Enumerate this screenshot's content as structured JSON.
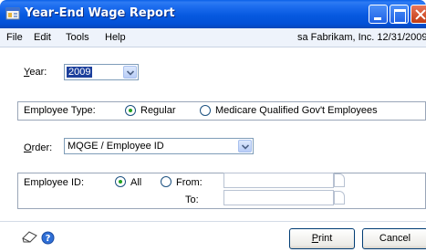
{
  "window": {
    "title": "Year-End Wage Report",
    "icon": "report-window-icon",
    "controls": [
      "minimize-icon",
      "maximize-icon",
      "close-icon"
    ]
  },
  "menu": {
    "items": [
      {
        "label": "File"
      },
      {
        "label": "Edit"
      },
      {
        "label": "Tools"
      },
      {
        "label": "Help"
      }
    ],
    "context": "sa  Fabrikam, Inc.  12/31/2009"
  },
  "form": {
    "year": {
      "label": "Year:",
      "accel": "Y",
      "label_rest": "ear:",
      "value": "2009"
    },
    "employee_type": {
      "label": "Employee Type:",
      "options": [
        {
          "label": "Regular",
          "selected": true
        },
        {
          "label": "Medicare Qualified Gov't Employees",
          "selected": false
        }
      ]
    },
    "order": {
      "label": "Order:",
      "accel": "O",
      "label_rest": "rder:",
      "value": "MQGE / Employee ID"
    },
    "employee_id": {
      "label": "Employee ID:",
      "options": [
        {
          "label": "All",
          "selected": true
        },
        {
          "label": "From:",
          "selected": false
        }
      ],
      "to_label": "To:",
      "from_value": "",
      "to_value": ""
    }
  },
  "footer": {
    "icons": [
      "note-icon",
      "help-icon"
    ],
    "print": {
      "label": "Print",
      "accel": "P",
      "label_rest": "rint"
    },
    "cancel": {
      "label": "Cancel"
    }
  },
  "colors": {
    "titlebar": "#0659e0",
    "selection": "#1c3f9c",
    "radio_dot": "#21a121"
  }
}
